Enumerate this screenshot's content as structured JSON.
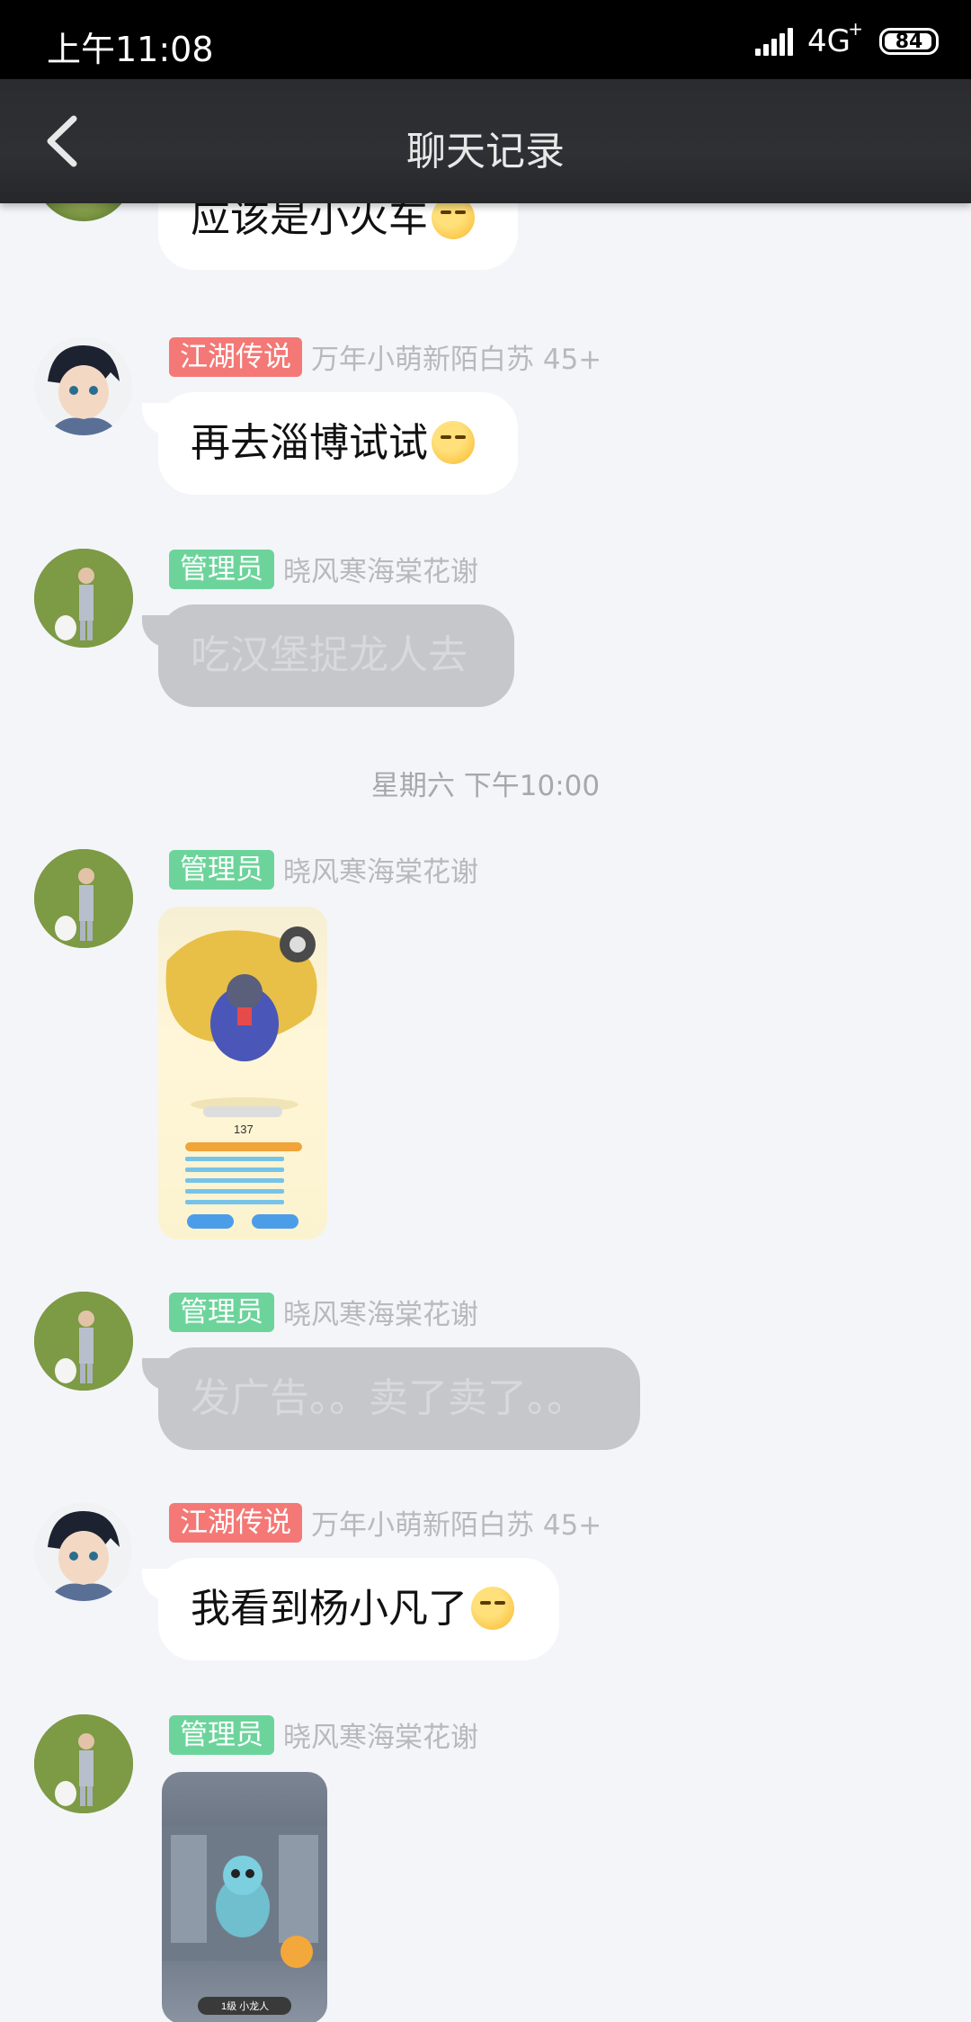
{
  "status_bar": {
    "time": "上午11:08",
    "network": "4G",
    "network_sup": "+",
    "battery": "84"
  },
  "nav": {
    "title": "聊天记录",
    "back_icon": "chevron-left-icon"
  },
  "messages": [
    {
      "type": "text",
      "text": "应该是小火车",
      "emoji": "laugh-cry-emoji",
      "bubble": "white"
    },
    {
      "type": "text",
      "badge": "江湖传说",
      "badge_color": "#f47876",
      "nick": "万年小萌新陌白苏 45+",
      "text": "再去淄博试试",
      "emoji": "smirk-emoji",
      "bubble": "white"
    },
    {
      "type": "text",
      "badge": "管理员",
      "badge_color": "#6cd49b",
      "nick": "晓风寒海棠花谢",
      "text": "吃汉堡捉龙人去",
      "bubble": "gray"
    },
    {
      "type": "timestamp",
      "text": "星期六 下午10:00"
    },
    {
      "type": "image",
      "badge": "管理员",
      "badge_color": "#6cd49b",
      "nick": "晓风寒海棠花谢",
      "image": "game-character-screenshot",
      "image_text": "137"
    },
    {
      "type": "text",
      "badge": "管理员",
      "badge_color": "#6cd49b",
      "nick": "晓风寒海棠花谢",
      "text": "发广告。。卖了卖了。。",
      "bubble": "gray"
    },
    {
      "type": "text",
      "badge": "江湖传说",
      "badge_color": "#f47876",
      "nick": "万年小萌新陌白苏 45+",
      "text": "我看到杨小凡了",
      "emoji": "smirk-emoji",
      "bubble": "white"
    },
    {
      "type": "image",
      "badge": "管理员",
      "badge_color": "#6cd49b",
      "nick": "晓风寒海棠花谢",
      "image": "little-dragon-screenshot",
      "image_text": "1级 小龙人"
    }
  ]
}
